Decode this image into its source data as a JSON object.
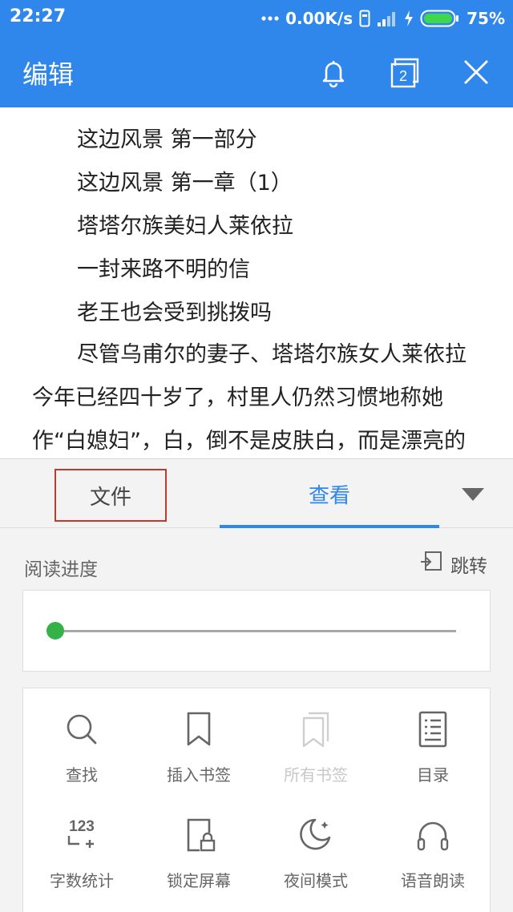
{
  "status_bar": {
    "time": "22:27",
    "network_speed": "0.00K/s",
    "battery": "75%"
  },
  "header": {
    "title": "编辑",
    "icons": [
      "bell-icon",
      "tabs-count-icon",
      "close-icon"
    ],
    "tabs_count": "2"
  },
  "document": {
    "lines": [
      "这边风景 第一部分",
      "这边风景 第一章（1）",
      "塔塔尔族美妇人莱依拉",
      "一封来路不明的信",
      "老王也会受到挑拨吗"
    ],
    "paragraph": "尽管乌甫尔的妻子、塔塔尔族女人莱依拉今年已经四十岁了，村里人仍然习惯地称她作“白媳妇”，白，倒不是皮肤白，而是漂亮的意思。她梳着长长的金色发辫，生着双眼"
  },
  "panel": {
    "tabs": [
      {
        "label": "文件",
        "active": false
      },
      {
        "label": "查看",
        "active": true
      }
    ],
    "collapse_icon": "triangle-down-icon",
    "reading_progress_label": "阅读进度",
    "jump_label": "跳转",
    "reading_progress": 0,
    "tools": [
      {
        "label": "查找",
        "icon": "search-icon",
        "enabled": true
      },
      {
        "label": "插入书签",
        "icon": "bookmark-icon",
        "enabled": true
      },
      {
        "label": "所有书签",
        "icon": "bookmarks-icon",
        "enabled": false
      },
      {
        "label": "目录",
        "icon": "toc-icon",
        "enabled": true
      },
      {
        "label": "字数统计",
        "icon": "word-count-icon",
        "enabled": true
      },
      {
        "label": "锁定屏幕",
        "icon": "lock-screen-icon",
        "enabled": true
      },
      {
        "label": "夜间模式",
        "icon": "night-mode-icon",
        "enabled": true
      },
      {
        "label": "语音朗读",
        "icon": "headphones-icon",
        "enabled": true
      }
    ]
  },
  "colors": {
    "brand_blue": "#2f87ec",
    "slider_green": "#34b248",
    "highlight_red": "#c0392b"
  }
}
